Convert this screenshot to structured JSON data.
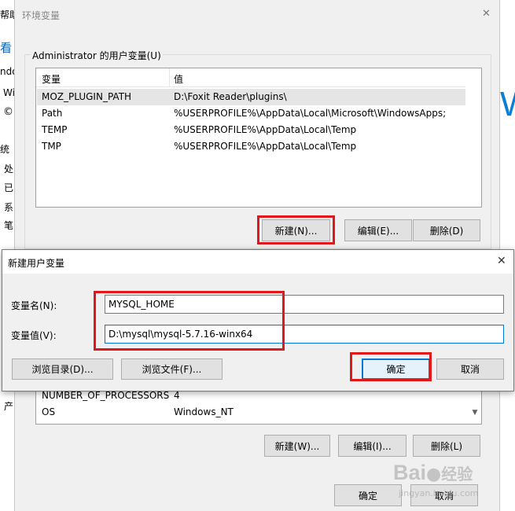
{
  "background": {
    "left_fragments": [
      "帮助(",
      "看",
      "ndo",
      "Wi",
      "©",
      "统",
      "处",
      "已",
      "系",
      "笔",
      "产"
    ],
    "right_fragment": "W"
  },
  "env_window": {
    "title": "环境变量",
    "close_glyph": "✕",
    "user_vars": {
      "group_label": "Administrator 的用户变量(U)",
      "columns": [
        "变量",
        "值"
      ],
      "rows": [
        {
          "name": "MOZ_PLUGIN_PATH",
          "value": "D:\\Foxit Reader\\plugins\\"
        },
        {
          "name": "Path",
          "value": "%USERPROFILE%\\AppData\\Local\\Microsoft\\WindowsApps;"
        },
        {
          "name": "TEMP",
          "value": "%USERPROFILE%\\AppData\\Local\\Temp"
        },
        {
          "name": "TMP",
          "value": "%USERPROFILE%\\AppData\\Local\\Temp"
        }
      ],
      "buttons": {
        "new": "新建(N)...",
        "edit": "编辑(E)...",
        "delete": "删除(D)"
      }
    },
    "sys_vars": {
      "rows": [
        {
          "name": "NUMBER_OF_PROCESSORS",
          "value": "4"
        },
        {
          "name": "OS",
          "value": "Windows_NT"
        }
      ],
      "buttons": {
        "new": "新建(W)...",
        "edit": "编辑(I)...",
        "delete": "删除(L)"
      }
    },
    "footer": {
      "ok": "确定",
      "cancel": "取消"
    }
  },
  "new_var_dialog": {
    "title": "新建用户变量",
    "close_glyph": "✕",
    "name_label": "变量名(N):",
    "name_value": "MYSQL_HOME",
    "value_label": "变量值(V):",
    "value_value": "D:\\mysql\\mysql-5.7.16-winx64",
    "browse_dir": "浏览目录(D)...",
    "browse_file": "浏览文件(F)...",
    "ok": "确定",
    "cancel": "取消"
  },
  "watermark": {
    "brand": "Bai",
    "brand2": "经验",
    "url": "jingyan.baidu.com"
  },
  "colors": {
    "highlight_red": "#e0181c",
    "focus_blue": "#0078d7"
  }
}
